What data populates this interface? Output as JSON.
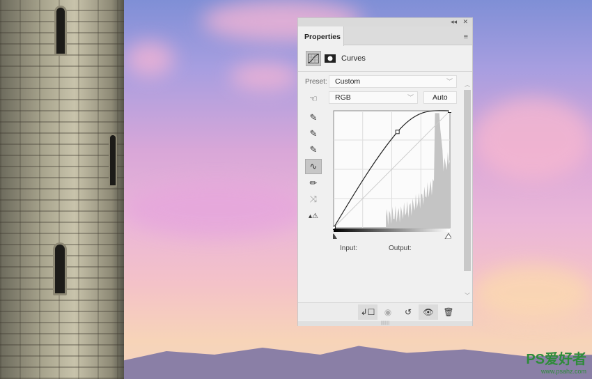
{
  "panel": {
    "title": "Properties",
    "adjustment_name": "Curves",
    "collapse_icon": "double-chevron-left-icon",
    "close_icon": "close-icon",
    "preset_label": "Preset:",
    "preset_value": "Custom",
    "channel_value": "RGB",
    "auto_label": "Auto",
    "input_label": "Input:",
    "output_label": "Output:"
  },
  "curve": {
    "points": [
      [
        0,
        0
      ],
      [
        140,
        209
      ],
      [
        255,
        255
      ]
    ],
    "range": [
      0,
      255
    ]
  },
  "watermark": {
    "text": "PS爱好者",
    "url": "www.psahz.com"
  },
  "colors": {
    "panel": "#f0f0f0",
    "selected": "#c6c6c6"
  }
}
